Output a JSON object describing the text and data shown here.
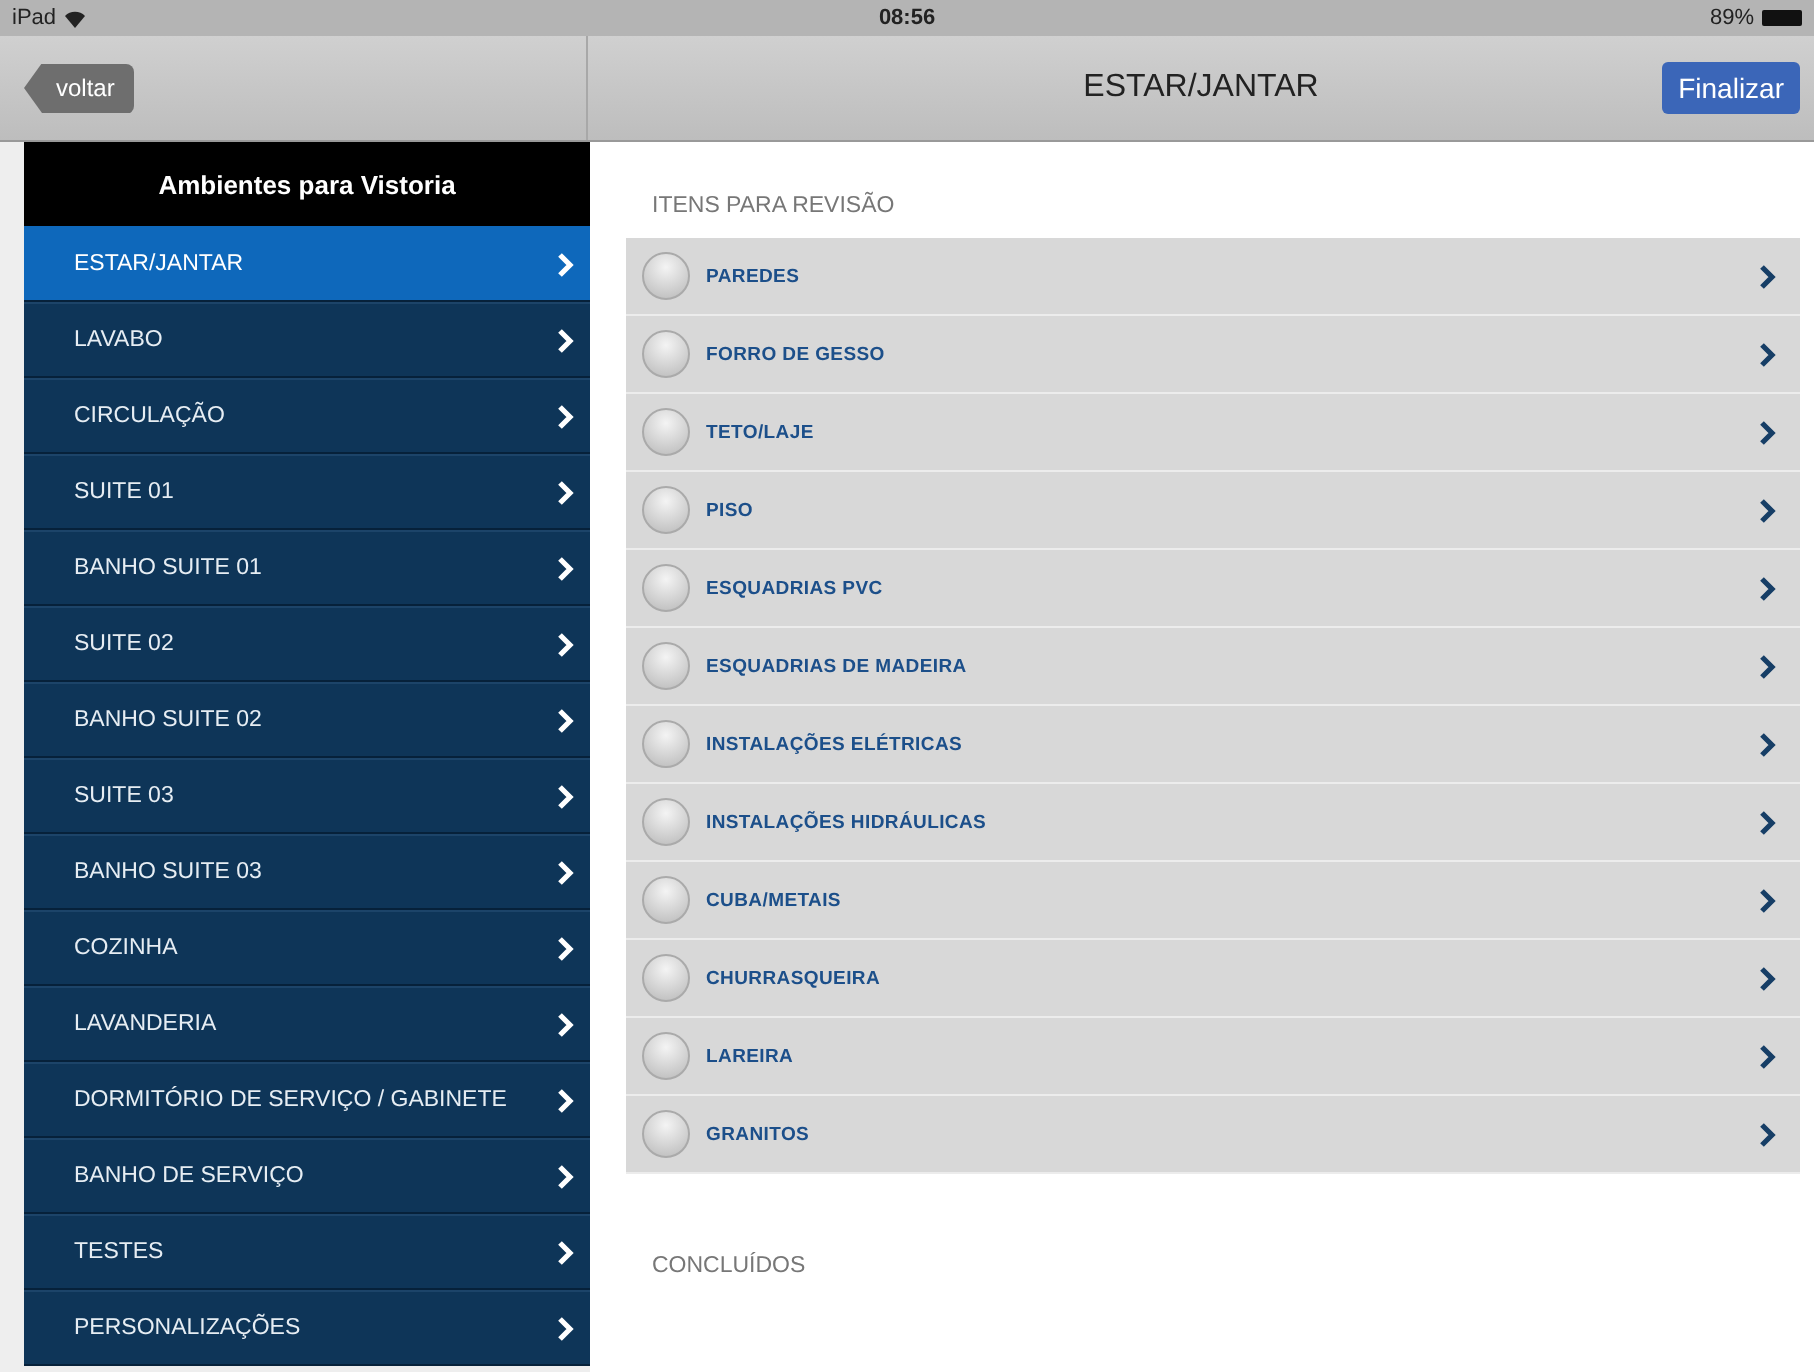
{
  "status_bar": {
    "device": "iPad",
    "time": "08:56",
    "battery": "89%"
  },
  "nav_bar": {
    "back": "voltar",
    "title": "ESTAR/JANTAR",
    "action": "Finalizar"
  },
  "sidebar": {
    "title": "Ambientes para Vistoria",
    "items": [
      {
        "label": "ESTAR/JANTAR",
        "selected": true
      },
      {
        "label": "LAVABO",
        "selected": false
      },
      {
        "label": "CIRCULAÇÃO",
        "selected": false
      },
      {
        "label": "SUITE 01",
        "selected": false
      },
      {
        "label": "BANHO SUITE 01",
        "selected": false
      },
      {
        "label": "SUITE 02",
        "selected": false
      },
      {
        "label": "BANHO SUITE 02",
        "selected": false
      },
      {
        "label": "SUITE 03",
        "selected": false
      },
      {
        "label": "BANHO SUITE 03",
        "selected": false
      },
      {
        "label": "COZINHA",
        "selected": false
      },
      {
        "label": "LAVANDERIA",
        "selected": false
      },
      {
        "label": "DORMITÓRIO DE SERVIÇO / GABINETE",
        "selected": false
      },
      {
        "label": "BANHO DE SERVIÇO",
        "selected": false
      },
      {
        "label": "TESTES",
        "selected": false
      },
      {
        "label": "PERSONALIZAÇÕES",
        "selected": false
      }
    ]
  },
  "review": {
    "title": "ITENS PARA REVISÃO",
    "items": [
      {
        "label": "PAREDES",
        "checked": false
      },
      {
        "label": "FORRO DE GESSO",
        "checked": false
      },
      {
        "label": "TETO/LAJE",
        "checked": false
      },
      {
        "label": "PISO",
        "checked": false
      },
      {
        "label": "ESQUADRIAS PVC",
        "checked": false
      },
      {
        "label": "ESQUADRIAS DE MADEIRA",
        "checked": false
      },
      {
        "label": "INSTALAÇÕES ELÉTRICAS",
        "checked": false
      },
      {
        "label": "INSTALAÇÕES HIDRÁULICAS",
        "checked": false
      },
      {
        "label": "CUBA/METAIS",
        "checked": false
      },
      {
        "label": "CHURRASQUEIRA",
        "checked": false
      },
      {
        "label": "LAREIRA",
        "checked": false
      },
      {
        "label": "GRANITOS",
        "checked": false
      }
    ]
  },
  "completed": {
    "title": "CONCLUÍDOS"
  }
}
